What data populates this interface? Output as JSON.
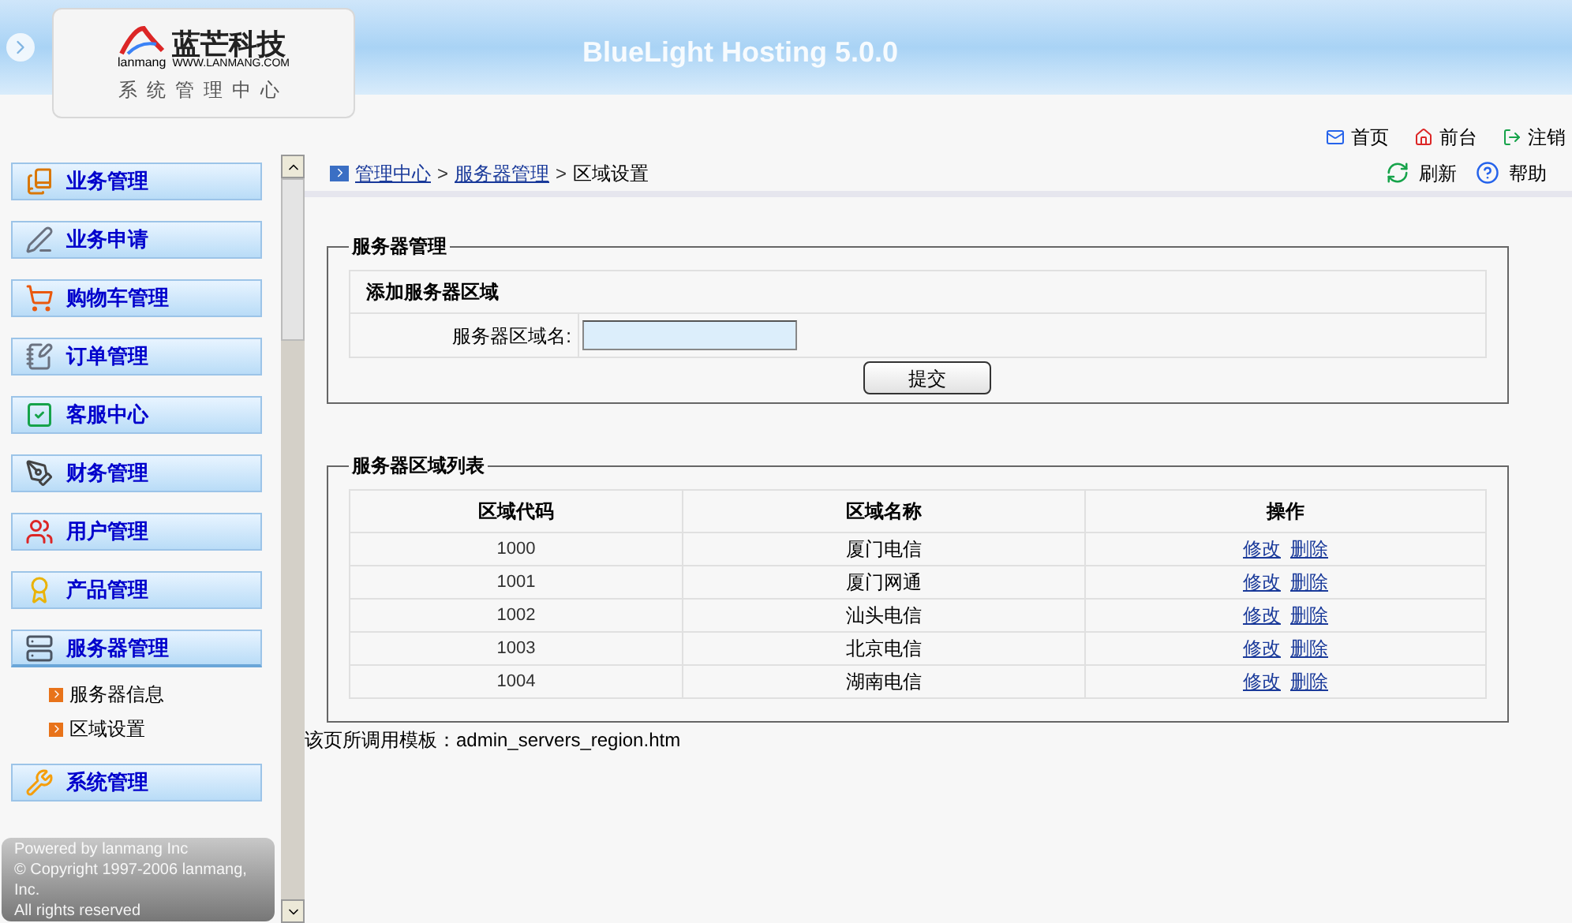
{
  "header": {
    "logo_brand": "蓝芒科技",
    "logo_latin": "lanmang",
    "logo_url": "WWW.LANMANG.COM",
    "logo_subtitle": "系统管理中心",
    "product_title": "BlueLight Hosting 5.0.0"
  },
  "top_links": [
    {
      "label": "首页"
    },
    {
      "label": "前台"
    },
    {
      "label": "注销"
    }
  ],
  "sidebar": {
    "items": [
      {
        "label": "业务管理",
        "expanded": false
      },
      {
        "label": "业务申请",
        "expanded": false
      },
      {
        "label": "购物车管理",
        "expanded": false
      },
      {
        "label": "订单管理",
        "expanded": false
      },
      {
        "label": "客服中心",
        "expanded": false
      },
      {
        "label": "财务管理",
        "expanded": false
      },
      {
        "label": "用户管理",
        "expanded": false
      },
      {
        "label": "产品管理",
        "expanded": false
      },
      {
        "label": "服务器管理",
        "expanded": true,
        "children": [
          {
            "label": "服务器信息"
          },
          {
            "label": "区域设置"
          }
        ]
      },
      {
        "label": "系统管理",
        "expanded": false
      }
    ],
    "footer": [
      "Powered by lanmang Inc",
      "© Copyright 1997-2006 lanmang, Inc.",
      "All rights reserved"
    ]
  },
  "breadcrumb": [
    {
      "kind": "link",
      "text": "管理中心"
    },
    {
      "kind": "sep",
      "text": ">"
    },
    {
      "kind": "link",
      "text": "服务器管理"
    },
    {
      "kind": "sep",
      "text": ">"
    },
    {
      "kind": "current",
      "text": "区域设置"
    }
  ],
  "toolbar": [
    {
      "label": "刷新"
    },
    {
      "label": "帮助"
    }
  ],
  "form_panel": {
    "legend": "服务器管理",
    "section_title": "添加服务器区域",
    "field_label": "服务器区域名:",
    "submit": "提交"
  },
  "list_panel": {
    "legend": "服务器区域列表",
    "columns": [
      "区域代码",
      "区域名称",
      "操作"
    ],
    "rows": [
      {
        "code": "1000",
        "name": "厦门电信",
        "actions": [
          "修改",
          "删除"
        ]
      },
      {
        "code": "1001",
        "name": "厦门网通",
        "actions": [
          "修改",
          "删除"
        ]
      },
      {
        "code": "1002",
        "name": "汕头电信",
        "actions": [
          "修改",
          "删除"
        ]
      },
      {
        "code": "1003",
        "name": "北京电信",
        "actions": [
          "修改",
          "删除"
        ]
      },
      {
        "code": "1004",
        "name": "湖南电信",
        "actions": [
          "修改",
          "删除"
        ]
      }
    ]
  },
  "template_note": "该页所调用模板：admin_servers_region.htm"
}
